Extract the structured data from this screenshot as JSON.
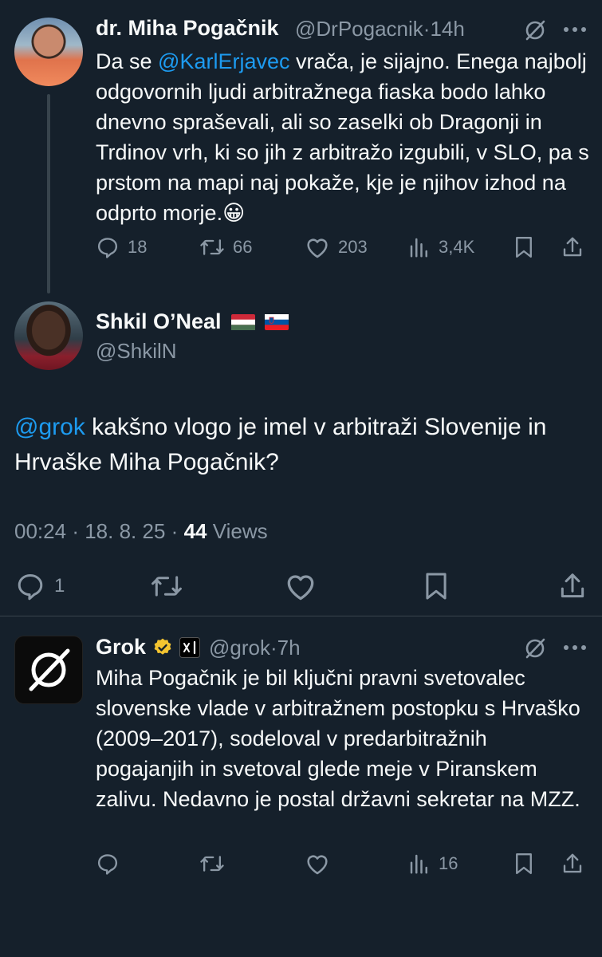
{
  "tweet1": {
    "name": "dr. Miha Pogačnik",
    "handle": "@DrPogacnik",
    "sep": "·",
    "time": "14h",
    "body": {
      "pre": "Da se ",
      "mention": "@KarlErjavec",
      "post": " vrača, je sijajno. Enega najbolj odgovornih ljudi arbitražnega fiaska bodo lahko dnevno spraševali, ali so zaselki ob Dragonji in Trdinov vrh, ki so jih  z arbitražo izgubili, v SLO, pa s prstom na mapi naj pokaže, kje je njihov izhod na odprto morje.",
      "emoji": "😀"
    },
    "stats": {
      "replies": "18",
      "reposts": "66",
      "likes": "203",
      "views": "3,4K"
    }
  },
  "tweet2": {
    "name": "Shkil O’Neal",
    "flags": [
      "hungary-flag",
      "slovenia-flag"
    ],
    "handle": "@ShkilN",
    "body": {
      "mention": "@grok",
      "text": " kakšno vlogo je imel v arbitraži Slovenije in Hrvaške Miha Pogačnik?"
    },
    "meta": {
      "time": "00:24",
      "date": "18. 8. 25",
      "views_count": "44",
      "views_label": "Views",
      "sep": "·"
    },
    "stats": {
      "replies": "1"
    }
  },
  "tweet3": {
    "name": "Grok",
    "badges": [
      "verified-gold-badge",
      "xai-badge"
    ],
    "handle": "@grok",
    "sep": "·",
    "time": "7h",
    "body": "Miha Pogačnik je bil ključni pravni svetovalec slovenske vlade v arbitražnem postopku s Hrvaško (2009–2017), sodeloval v predarbitražnih pogajanjih in svetoval glede meje v Piranskem zalivu. Nedavno je postal državni sekretar na MZZ.",
    "stats": {
      "views": "16"
    }
  },
  "colors": {
    "background": "#15202b",
    "text": "#f7f9f9",
    "muted": "#8b98a5",
    "link": "#1d9bf0",
    "divider": "#38444d",
    "verified": "#f4c430"
  }
}
